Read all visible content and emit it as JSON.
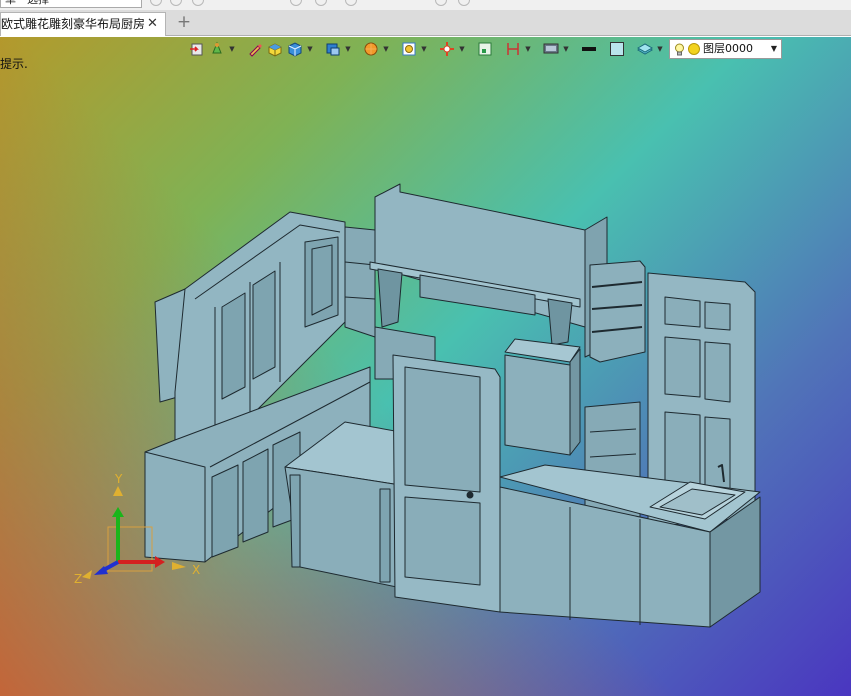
{
  "top_toolbar": {
    "selector_value": "单一选择"
  },
  "tabs": [
    {
      "label": "欧式雕花雕刻豪华布局厨房]",
      "active": true
    }
  ],
  "new_tab_label": "+",
  "close_label": "✕",
  "viewport": {
    "hint_text": "提示.",
    "layer_name": "图层0000",
    "axis_labels": {
      "x": "X",
      "y": "Y",
      "z": "Z"
    }
  },
  "icons": [
    "import-icon",
    "sketch-icon",
    "pencil-icon",
    "block-icon",
    "solid-cube-icon",
    "view-cube-icon",
    "render-icon",
    "zoom-fit-icon",
    "move-icon",
    "snap-icon",
    "dimension-icon",
    "display-icon",
    "line-style-icon",
    "color-fill-icon",
    "layer-stack-icon"
  ],
  "colors": {
    "model_fill": "#8fb3bf",
    "model_edge": "#1e2a30",
    "tab_active": "#ffffff"
  }
}
